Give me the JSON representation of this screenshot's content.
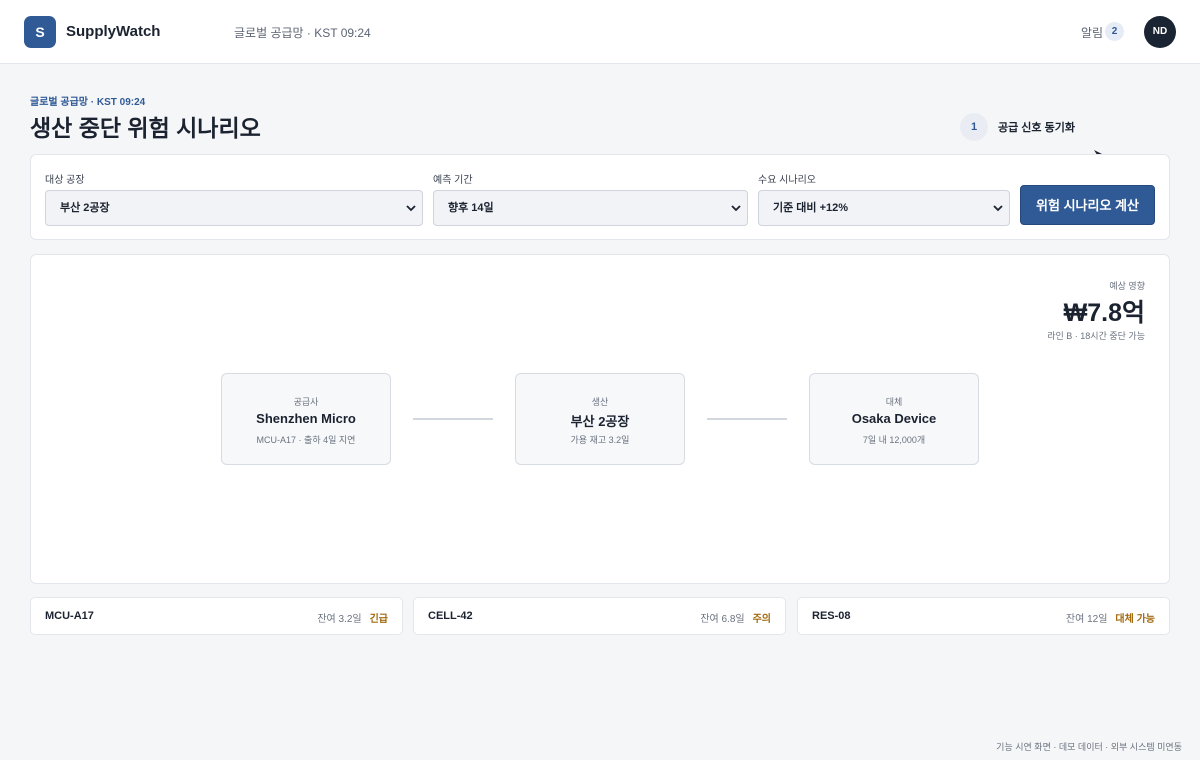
{
  "header": {
    "logo_letter": "S",
    "brand": "SupplyWatch",
    "context": "글로벌 공급망 · KST 09:24",
    "alerts_label": "알림",
    "alerts_count": "2",
    "avatar_initials": "ND"
  },
  "page": {
    "eyebrow": "글로벌 공급망 · KST 09:24",
    "title": "생산 중단 위험 시나리오",
    "step_number": "1",
    "step_label": "공급 신호 동기화"
  },
  "filters": {
    "plant_label": "대상 공장",
    "plant_value": "부산 2공장",
    "period_label": "예측 기간",
    "period_value": "향후 14일",
    "demand_label": "수요 시나리오",
    "demand_value": "기준 대비 +12%",
    "calculate_button": "위험 시나리오 계산"
  },
  "impact": {
    "label": "예상 영향",
    "value": "₩7.8억",
    "note": "라인 B · 18시간 중단 가능"
  },
  "flow": {
    "nodes": [
      {
        "category": "공급사",
        "name": "Shenzhen Micro",
        "detail": "MCU-A17 · 출하 4일 지연"
      },
      {
        "category": "생산",
        "name": "부산 2공장",
        "detail": "가용 재고 3.2일"
      },
      {
        "category": "대체",
        "name": "Osaka Device",
        "detail": "7일 내 12,000개"
      }
    ]
  },
  "materials": [
    {
      "code": "MCU-A17",
      "remaining": "잔여 3.2일",
      "status": "긴급"
    },
    {
      "code": "CELL-42",
      "remaining": "잔여 6.8일",
      "status": "주의"
    },
    {
      "code": "RES-08",
      "remaining": "잔여 12일",
      "status": "대체 가능"
    }
  ],
  "footer": {
    "note": "기능 시연 화면 · 데모 데이터 · 외부 시스템 미연동"
  },
  "colors": {
    "primary": "#2f5a96",
    "status_text": "#a36a10",
    "avatar_bg": "#1b2433"
  }
}
